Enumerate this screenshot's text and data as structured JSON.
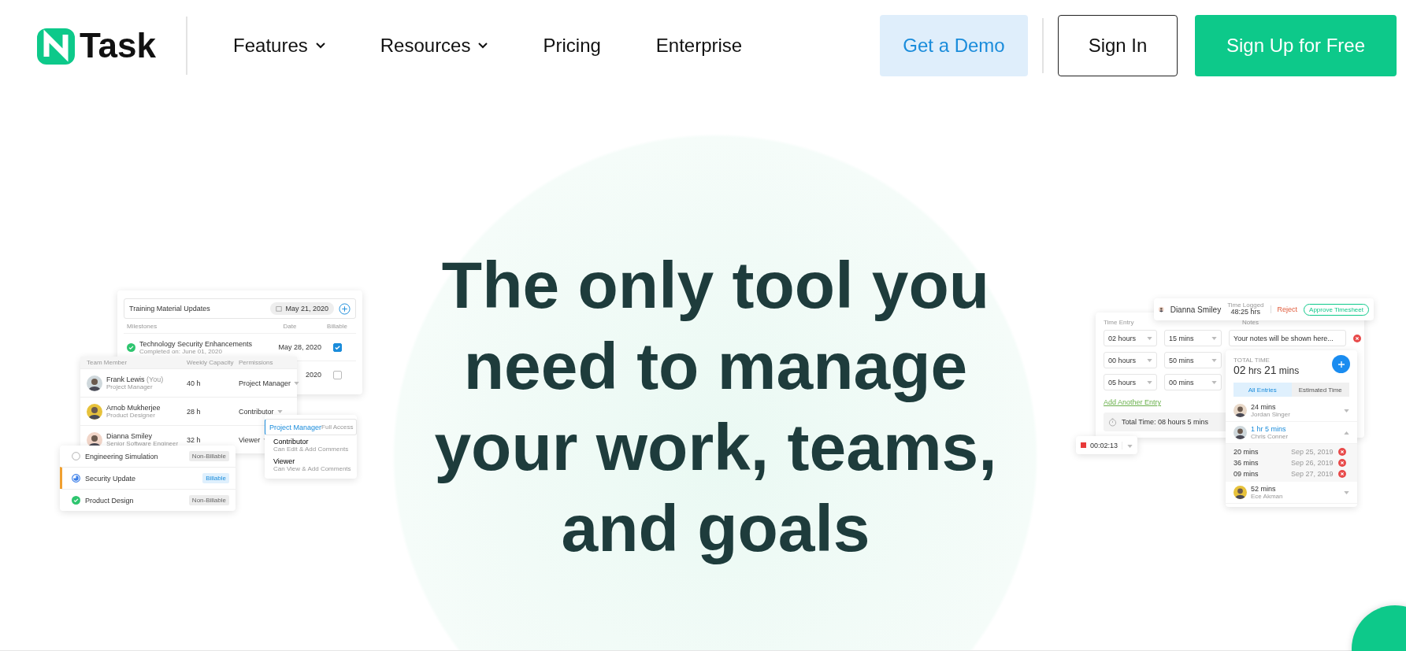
{
  "header": {
    "logo_text": "Task",
    "nav": [
      {
        "label": "Features",
        "dropdown": true
      },
      {
        "label": "Resources",
        "dropdown": true
      },
      {
        "label": "Pricing",
        "dropdown": false
      },
      {
        "label": "Enterprise",
        "dropdown": false
      }
    ],
    "buttons": [
      {
        "label": "Get a Demo",
        "kind": "demo"
      },
      {
        "label": "Sign In",
        "kind": "outline"
      },
      {
        "label": "Sign Up for Free",
        "kind": "primary"
      }
    ]
  },
  "headline_lines": [
    "The only tool you",
    "need to manage",
    "your work, teams,",
    "and goals"
  ],
  "milestone_card": {
    "input": "Training Material Updates",
    "date": "May 21, 2020",
    "columns": [
      "Milestones",
      "Date",
      "Billable"
    ],
    "rows": [
      {
        "title": "Technology Security Enhancements",
        "subtitle": "Completed on: June 01, 2020",
        "date": "May 28, 2020",
        "billable": true,
        "done": true
      },
      {
        "date": "2020",
        "billable": false
      }
    ]
  },
  "team_card": {
    "columns": [
      "Team Member",
      "Weekly Capacity",
      "Permissions"
    ],
    "members": [
      {
        "name": "Frank Lewis",
        "tag": "(You)",
        "role": "Project Manager",
        "capacity": "40 h",
        "permission": "Project Manager"
      },
      {
        "name": "Arnob Mukherjee",
        "role": "Product Designer",
        "capacity": "28 h",
        "permission": "Contributor"
      },
      {
        "name": "Dianna Smiley",
        "role": "Senior Software Engineer",
        "capacity": "32 h",
        "permission": "Viewer"
      }
    ]
  },
  "permission_menu": [
    {
      "label": "Project Manager",
      "description": "Full Access",
      "selected": true
    },
    {
      "label": "Contributor",
      "description": "Can Edit & Add Comments",
      "selected": false
    },
    {
      "label": "Viewer",
      "description": "Can View & Add Comments",
      "selected": false
    }
  ],
  "task_list": [
    {
      "name": "Engineering Simulation",
      "kind": "todo",
      "billing": "Non-Billable",
      "billable": false,
      "active": false
    },
    {
      "name": "Security Update",
      "kind": "in_progress",
      "billing": "Billable",
      "billable": true,
      "active": true
    },
    {
      "name": "Product Design",
      "kind": "done",
      "billing": "Non-Billable",
      "billable": false,
      "active": false
    }
  ],
  "timesheet_bar": {
    "name": "Dianna Smiley",
    "logged_label": "Time Logged",
    "logged_value": "48:25 hrs",
    "reject": "Reject",
    "approve": "Approve Timesheet"
  },
  "time_entry": {
    "label": "Time Entry",
    "notes_label": "Notes",
    "notes_placeholder": "Your notes will be shown here...",
    "rows": [
      {
        "hours": "02 hours",
        "mins": "15 mins"
      },
      {
        "hours": "00 hours",
        "mins": "50 mins"
      },
      {
        "hours": "05 hours",
        "mins": "00 mins"
      }
    ],
    "add_link": "Add Another Entry",
    "total": "Total Time: 08 hours 5 mins"
  },
  "timer": {
    "time": "00:02:13"
  },
  "total_panel": {
    "label": "TOTAL TIME",
    "value": "**02** hrs **21** mins",
    "tabs": [
      {
        "label": "All Entries",
        "selected": true
      },
      {
        "label": "Estimated Time",
        "selected": false
      }
    ],
    "entries": [
      {
        "duration": "24 mins",
        "name": "Jordan Singer",
        "expanded": false
      },
      {
        "duration": "1 hr 5 mins",
        "name": "Chris Conner",
        "expanded": true,
        "children": [
          {
            "duration": "20 mins",
            "date": "Sep 25, 2019"
          },
          {
            "duration": "36 mins",
            "date": "Sep 26, 2019"
          },
          {
            "duration": "09 mins",
            "date": "Sep 27, 2019"
          }
        ]
      },
      {
        "duration": "52 mins",
        "name": "Ece Akman",
        "expanded": false
      }
    ]
  }
}
